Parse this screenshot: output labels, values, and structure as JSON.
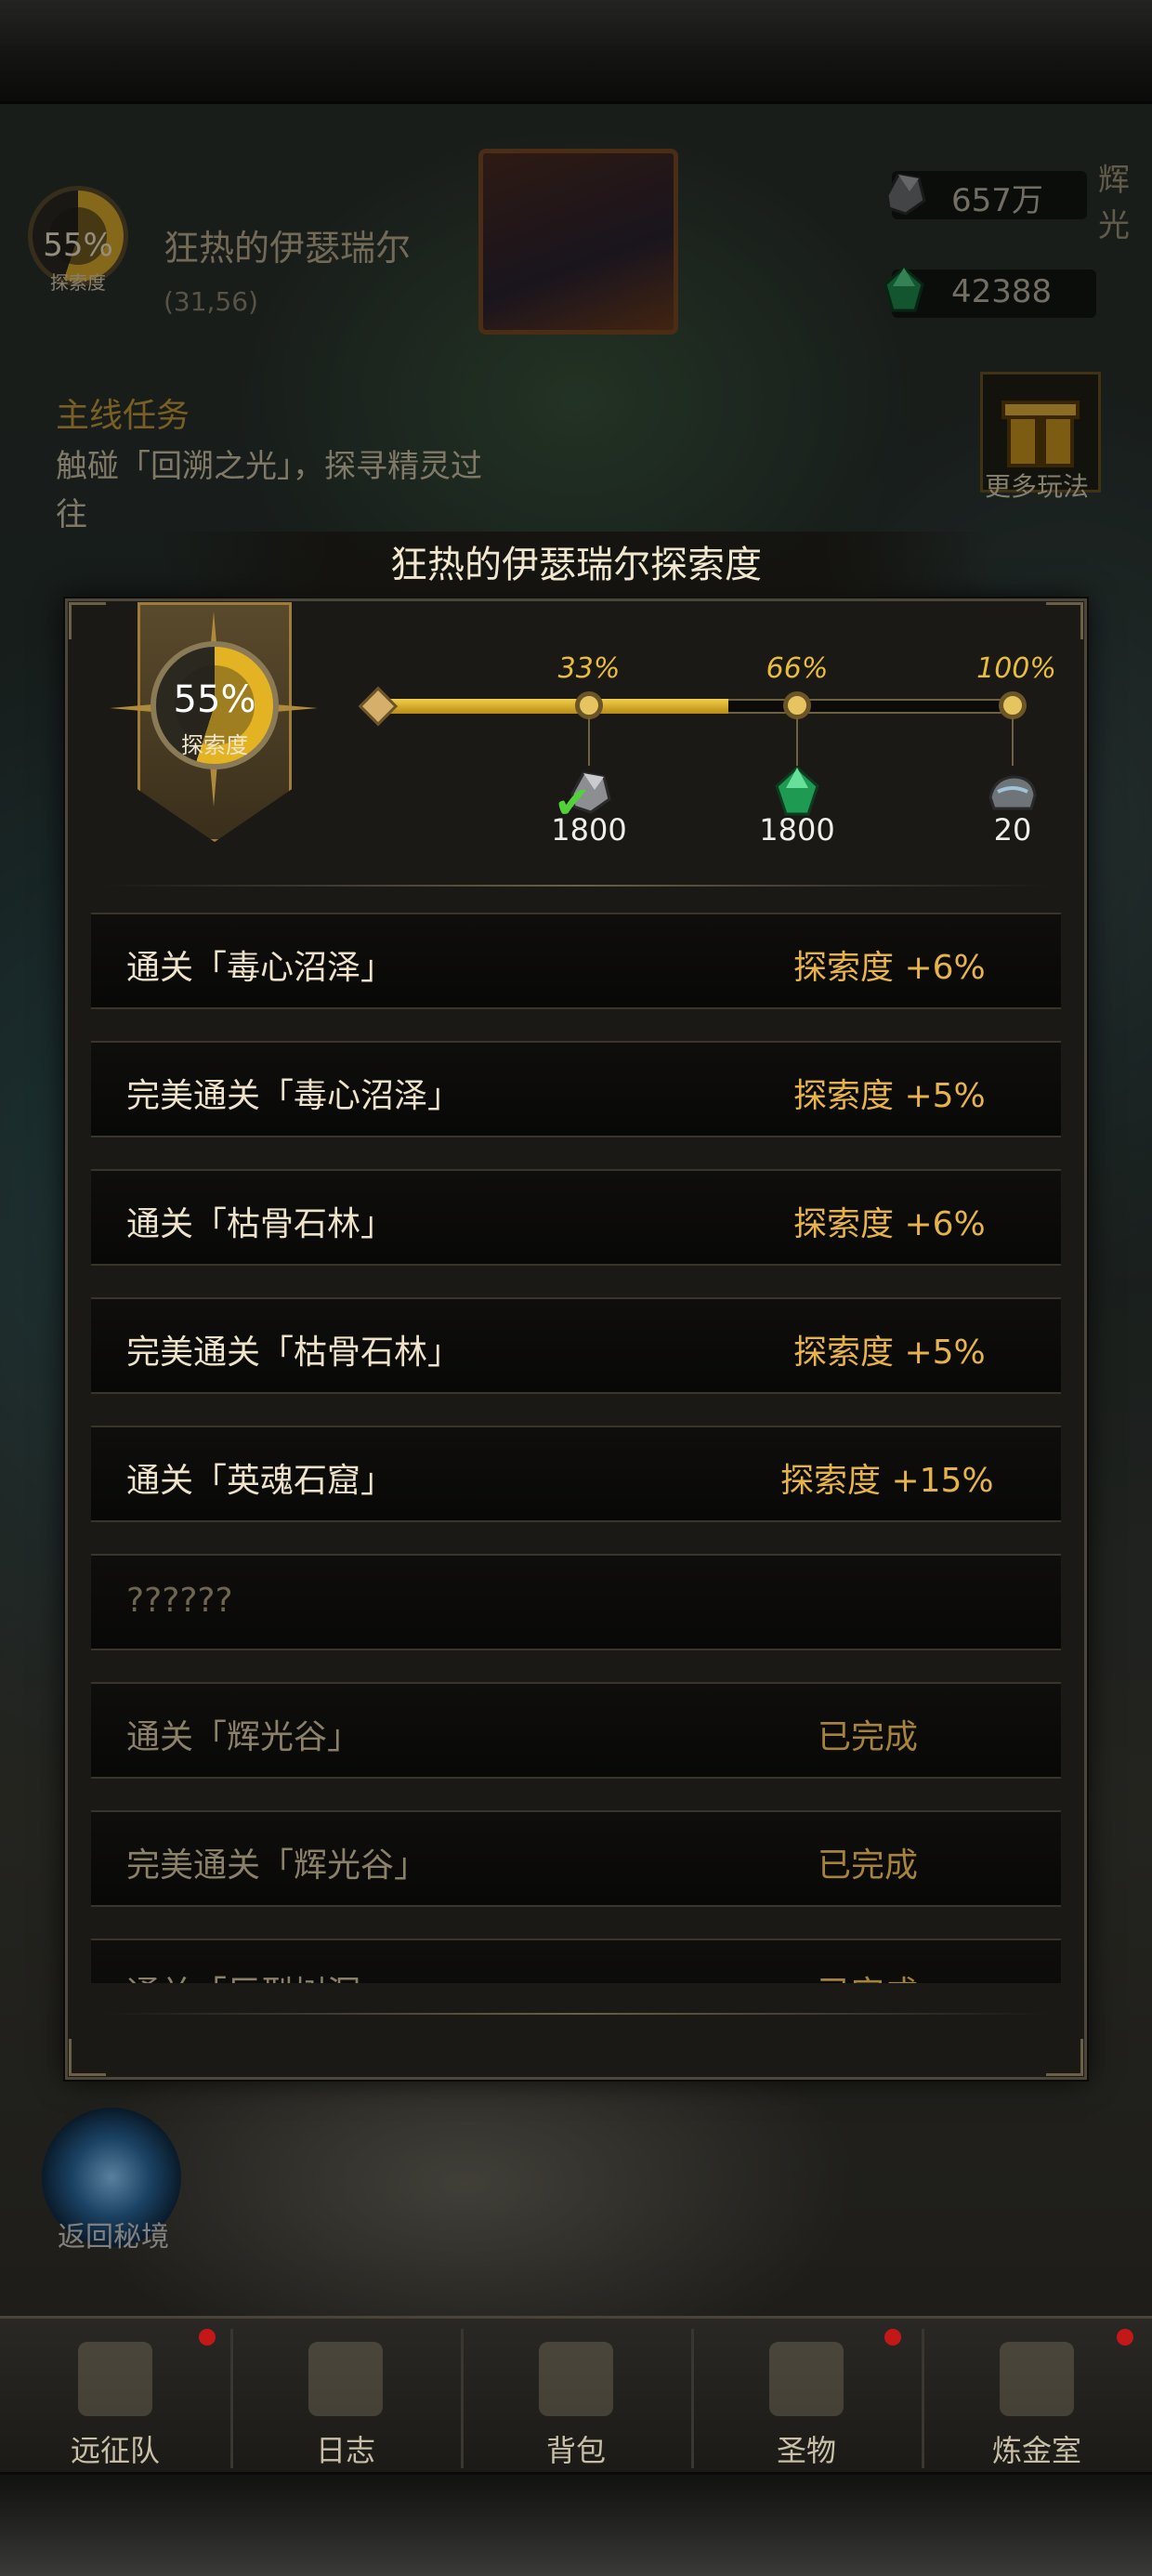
{
  "hud": {
    "exploration_percent": "55%",
    "exploration_label": "探索度",
    "map_title": "狂热的伊瑟瑞尔",
    "coordinates": "(31,56)",
    "resources": [
      {
        "icon": "ore-icon",
        "value": "657万"
      },
      {
        "icon": "emerald-icon",
        "value": "42388"
      }
    ],
    "cut_text": "辉光",
    "main_quest": {
      "title": "主线任务",
      "text": "触碰「回溯之光」，探寻精灵过往"
    },
    "more_play_label": "更多玩法",
    "return_label": "返回秘境"
  },
  "dialog": {
    "title": "狂热的伊瑟瑞尔探索度",
    "badge_percent": "55%",
    "badge_label": "探索度",
    "progress": 0.55,
    "milestones": [
      {
        "label": "33%",
        "count": "1800",
        "icon": "ore-icon",
        "claimed": true
      },
      {
        "label": "66%",
        "count": "1800",
        "icon": "emerald-icon",
        "claimed": false
      },
      {
        "label": "100%",
        "count": "20",
        "icon": "rock-chest-icon",
        "claimed": false
      }
    ],
    "rows": [
      {
        "name": "通关「毒心沼泽」",
        "value": "探索度  +6%",
        "state": "pending"
      },
      {
        "name": "完美通关「毒心沼泽」",
        "value": "探索度  +5%",
        "state": "pending"
      },
      {
        "name": "通关「枯骨石林」",
        "value": "探索度  +6%",
        "state": "pending"
      },
      {
        "name": "完美通关「枯骨石林」",
        "value": "探索度  +5%",
        "state": "pending"
      },
      {
        "name": "通关「英魂石窟」",
        "value": "探索度  +15%",
        "state": "pending"
      },
      {
        "name": "??????",
        "value": "",
        "state": "hidden"
      },
      {
        "name": "通关「辉光谷」",
        "value": "已完成",
        "state": "done"
      },
      {
        "name": "完美通关「辉光谷」",
        "value": "已完成",
        "state": "done"
      },
      {
        "name": "通关「巨型树洞」",
        "value": "已完成",
        "state": "done"
      }
    ]
  },
  "nav": [
    {
      "label": "远征队",
      "icon": "viking-helmet-icon",
      "badge": true
    },
    {
      "label": "日志",
      "icon": "scroll-log-icon",
      "badge": false
    },
    {
      "label": "背包",
      "icon": "backpack-icon",
      "badge": false
    },
    {
      "label": "圣物",
      "icon": "torch-relic-icon",
      "badge": true
    },
    {
      "label": "炼金室",
      "icon": "alchemy-icon",
      "badge": true
    }
  ],
  "colors": {
    "accent_gold": "#e8bd3a",
    "value_gold": "#e6b24a",
    "done_text": "#a6833c",
    "badge_red": "#c41818",
    "check_green": "#52d13a"
  }
}
